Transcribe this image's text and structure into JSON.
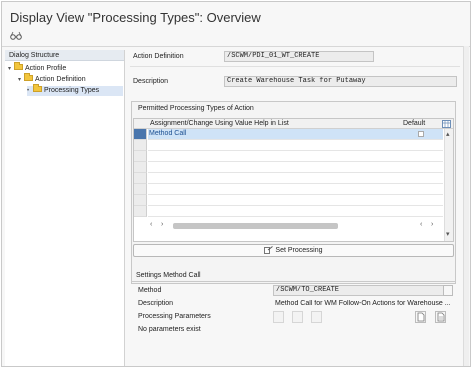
{
  "window": {
    "title": "Display View \"Processing Types\": Overview"
  },
  "toolbar": {
    "icons": [
      "glasses-icon"
    ]
  },
  "dialog_structure": {
    "header": "Dialog Structure",
    "items": [
      {
        "label": "Action Profile",
        "level": 0,
        "expanded": true
      },
      {
        "label": "Action Definition",
        "level": 1,
        "expanded": true
      },
      {
        "label": "Processing Types",
        "level": 2,
        "selected": true
      }
    ]
  },
  "action_definition": {
    "label": "Action Definition",
    "value": "/SCWM/PDI_01_WT_CREATE"
  },
  "description": {
    "label": "Description",
    "value": "Create Warehouse Task for Putaway"
  },
  "permitted_types": {
    "title": "Permitted Processing Types of Action",
    "columns": [
      "Assignment/Change Using Value Help in List",
      "Default"
    ],
    "rows": [
      {
        "assignment": "Method Call",
        "default": false
      }
    ]
  },
  "set_processing": {
    "label": "Set Processing"
  },
  "settings": {
    "title": "Settings Method Call",
    "method_label": "Method",
    "method_value": "/SCWM/TO_CREATE",
    "description_label": "Description",
    "description_value": "Method Call for WM Follow-On Actions for Warehouse ...",
    "processing_parameters_label": "Processing Parameters",
    "no_parameters_text": "No parameters exist"
  },
  "colors": {
    "selected_row_bg": "#cfe3f7",
    "tree_selection_bg": "#dbe6f5",
    "folder": "#f2c53d"
  }
}
